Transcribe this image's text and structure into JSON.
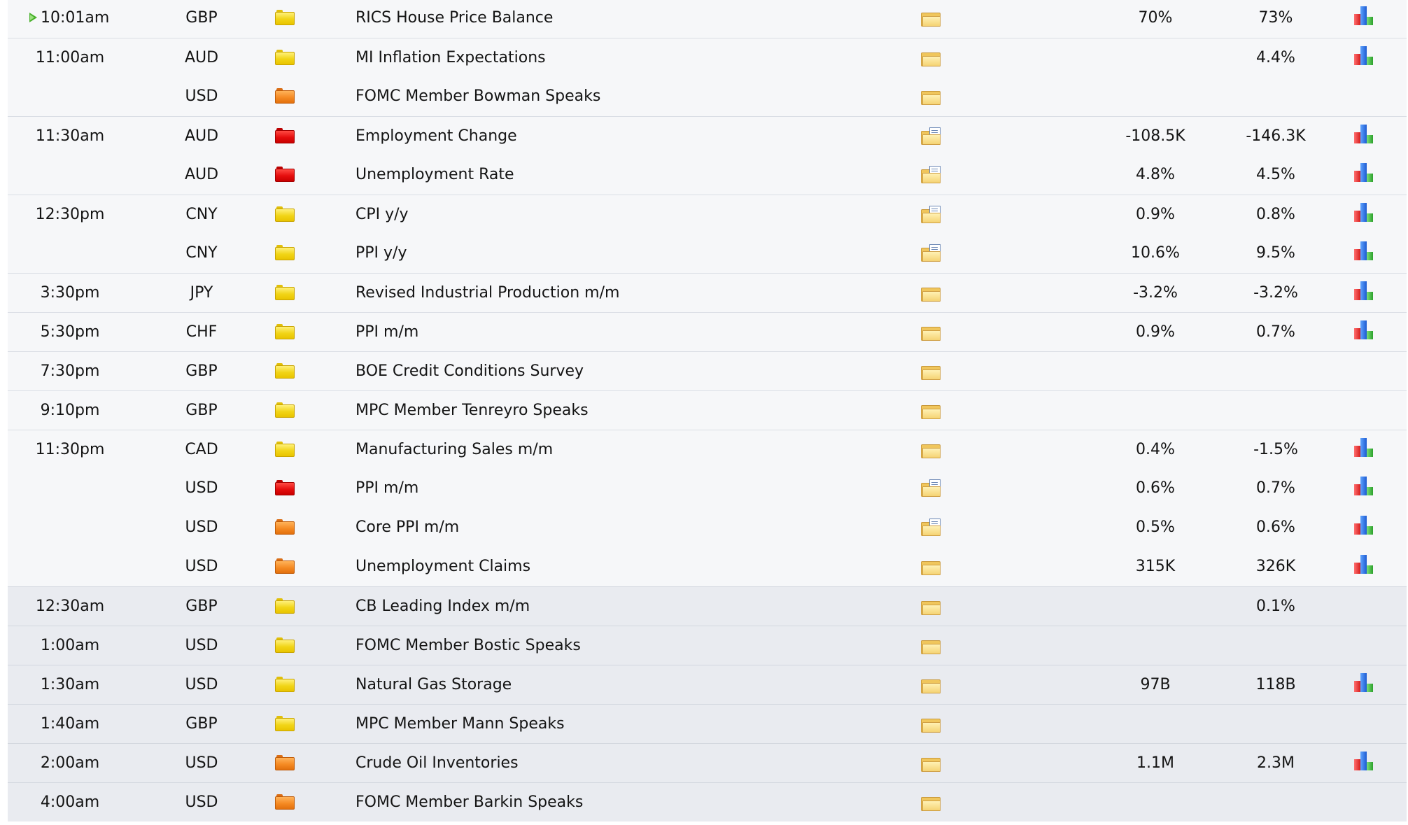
{
  "colors": {
    "today_row_bg": "#f6f7f9",
    "next_day_row_bg": "#e9ebf0",
    "impact_low": "#f1d416",
    "impact_medium": "#f58a23",
    "impact_high": "#e50d0d"
  },
  "rows": [
    {
      "time": "10:01am",
      "currency": "GBP",
      "impact": "low",
      "event": "RICS House Price Balance",
      "detail_icon": "folder",
      "actual": "70%",
      "previous": "73%",
      "graph": true,
      "current": true
    },
    {
      "time": "11:00am",
      "currency": "AUD",
      "impact": "low",
      "event": "MI Inflation Expectations",
      "detail_icon": "folder",
      "actual": "",
      "previous": "4.4%",
      "graph": true
    },
    {
      "time": "",
      "currency": "USD",
      "impact": "medium",
      "event": "FOMC Member Bowman Speaks",
      "detail_icon": "folder",
      "actual": "",
      "previous": "",
      "graph": false
    },
    {
      "time": "11:30am",
      "currency": "AUD",
      "impact": "high",
      "event": "Employment Change",
      "detail_icon": "folder-doc",
      "actual": "-108.5K",
      "previous": "-146.3K",
      "graph": true
    },
    {
      "time": "",
      "currency": "AUD",
      "impact": "high",
      "event": "Unemployment Rate",
      "detail_icon": "folder-doc",
      "actual": "4.8%",
      "previous": "4.5%",
      "graph": true
    },
    {
      "time": "12:30pm",
      "currency": "CNY",
      "impact": "low",
      "event": "CPI y/y",
      "detail_icon": "folder-doc",
      "actual": "0.9%",
      "previous": "0.8%",
      "graph": true
    },
    {
      "time": "",
      "currency": "CNY",
      "impact": "low",
      "event": "PPI y/y",
      "detail_icon": "folder-doc",
      "actual": "10.6%",
      "previous": "9.5%",
      "graph": true
    },
    {
      "time": "3:30pm",
      "currency": "JPY",
      "impact": "low",
      "event": "Revised Industrial Production m/m",
      "detail_icon": "folder",
      "actual": "-3.2%",
      "previous": "-3.2%",
      "graph": true
    },
    {
      "time": "5:30pm",
      "currency": "CHF",
      "impact": "low",
      "event": "PPI m/m",
      "detail_icon": "folder",
      "actual": "0.9%",
      "previous": "0.7%",
      "graph": true
    },
    {
      "time": "7:30pm",
      "currency": "GBP",
      "impact": "low",
      "event": "BOE Credit Conditions Survey",
      "detail_icon": "folder",
      "actual": "",
      "previous": "",
      "graph": false
    },
    {
      "time": "9:10pm",
      "currency": "GBP",
      "impact": "low",
      "event": "MPC Member Tenreyro Speaks",
      "detail_icon": "folder",
      "actual": "",
      "previous": "",
      "graph": false
    },
    {
      "time": "11:30pm",
      "currency": "CAD",
      "impact": "low",
      "event": "Manufacturing Sales m/m",
      "detail_icon": "folder",
      "actual": "0.4%",
      "previous": "-1.5%",
      "graph": true
    },
    {
      "time": "",
      "currency": "USD",
      "impact": "high",
      "event": "PPI m/m",
      "detail_icon": "folder-doc",
      "actual": "0.6%",
      "previous": "0.7%",
      "graph": true
    },
    {
      "time": "",
      "currency": "USD",
      "impact": "medium",
      "event": "Core PPI m/m",
      "detail_icon": "folder-doc",
      "actual": "0.5%",
      "previous": "0.6%",
      "graph": true
    },
    {
      "time": "",
      "currency": "USD",
      "impact": "medium",
      "event": "Unemployment Claims",
      "detail_icon": "folder",
      "actual": "315K",
      "previous": "326K",
      "graph": true
    },
    {
      "time": "12:30am",
      "currency": "GBP",
      "impact": "low",
      "event": "CB Leading Index m/m",
      "detail_icon": "folder",
      "actual": "",
      "previous": "0.1%",
      "graph": false,
      "next_day": true
    },
    {
      "time": "1:00am",
      "currency": "USD",
      "impact": "low",
      "event": "FOMC Member Bostic Speaks",
      "detail_icon": "folder",
      "actual": "",
      "previous": "",
      "graph": false,
      "next_day": true
    },
    {
      "time": "1:30am",
      "currency": "USD",
      "impact": "low",
      "event": "Natural Gas Storage",
      "detail_icon": "folder",
      "actual": "97B",
      "previous": "118B",
      "graph": true,
      "next_day": true
    },
    {
      "time": "1:40am",
      "currency": "GBP",
      "impact": "low",
      "event": "MPC Member Mann Speaks",
      "detail_icon": "folder",
      "actual": "",
      "previous": "",
      "graph": false,
      "next_day": true
    },
    {
      "time": "2:00am",
      "currency": "USD",
      "impact": "medium",
      "event": "Crude Oil Inventories",
      "detail_icon": "folder",
      "actual": "1.1M",
      "previous": "2.3M",
      "graph": true,
      "next_day": true
    },
    {
      "time": "4:00am",
      "currency": "USD",
      "impact": "medium",
      "event": "FOMC Member Barkin Speaks",
      "detail_icon": "folder",
      "actual": "",
      "previous": "",
      "graph": false,
      "next_day": true
    }
  ]
}
